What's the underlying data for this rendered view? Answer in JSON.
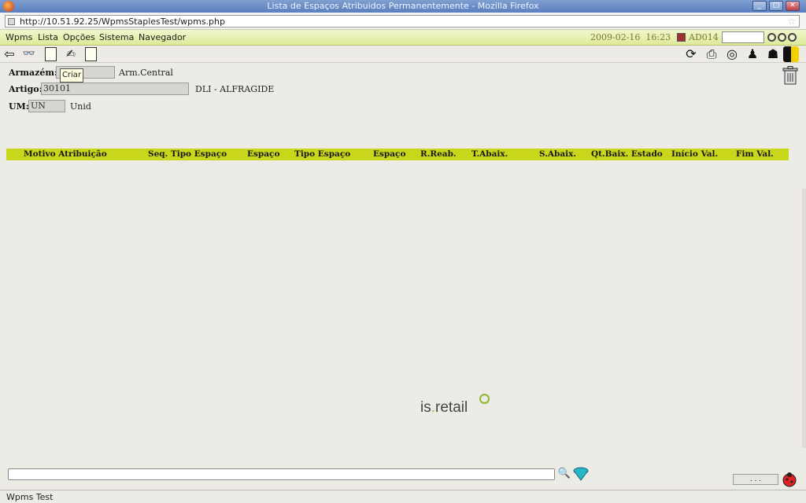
{
  "window": {
    "title": "Lista de Espaços Atribuidos Permanentemente - Mozilla Firefox"
  },
  "browser": {
    "url": "http://10.51.92.25/WpmsStaplesTest/wpms.php"
  },
  "menu": {
    "items": [
      "Wpms",
      "Lista",
      "Opções",
      "Sistema",
      "Navegador"
    ]
  },
  "header": {
    "date": "2009-02-16",
    "time": "16:23",
    "user": "AD014"
  },
  "form": {
    "armazem": {
      "label": "Armazém:",
      "value": "",
      "desc": "Arm.Central"
    },
    "artigo": {
      "label": "Artigo:",
      "value": "30101",
      "desc": "DLI - ALFRAGIDE"
    },
    "um": {
      "label": "UM:",
      "value": "UN",
      "desc": "Unid"
    },
    "tooltip": "Criar"
  },
  "table": {
    "columns": [
      "Motivo Atribuição",
      "Seq. Tipo Espaço",
      "Espaço",
      "Tipo Espaço",
      "Espaço",
      "R.Reab.",
      "T.Abaix.",
      "S.Abaix.",
      "Qt.Baix. Estado",
      "Início Val.",
      "Fim Val."
    ]
  },
  "logo": {
    "prefix": "is",
    "dot": ".",
    "suffix": "retail"
  },
  "footer": {
    "status_box": ". . .",
    "status_text": "Wpms Test"
  },
  "colors": {
    "menu_bg": "#dfe99a",
    "table_header": "#c8d61c",
    "titlebar": "#7f9fd0",
    "logo_accent": "#8db92e"
  },
  "icons": [
    "back-arrow-icon",
    "binoculars-icon",
    "new-document-icon",
    "edit-icon",
    "copy-document-icon",
    "refresh-icon",
    "print-icon",
    "help-lifebuoy-icon",
    "exit-icon",
    "user-icon",
    "moon-icon",
    "trash-icon",
    "search-binoculars-icon",
    "filter-icon",
    "bug-icon"
  ]
}
